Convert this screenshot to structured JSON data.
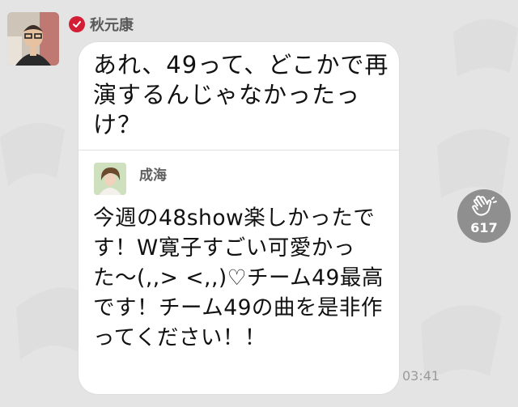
{
  "post": {
    "sender_name": "秋元康",
    "message": "あれ、49って、どこかで再演するんじゃなかったっけ？",
    "time": "03:41"
  },
  "reply": {
    "name": "成海",
    "text": "今週の48show楽しかったです！W寛子すごい可愛かった〜(,,> <,,)♡チーム49最高です！チーム49の曲を是非作ってください！！"
  },
  "reaction": {
    "icon": "clap-icon",
    "count": "617"
  },
  "colors": {
    "verified": "#d31f35",
    "background": "#e4e4e4",
    "bubble": "#ffffff"
  }
}
